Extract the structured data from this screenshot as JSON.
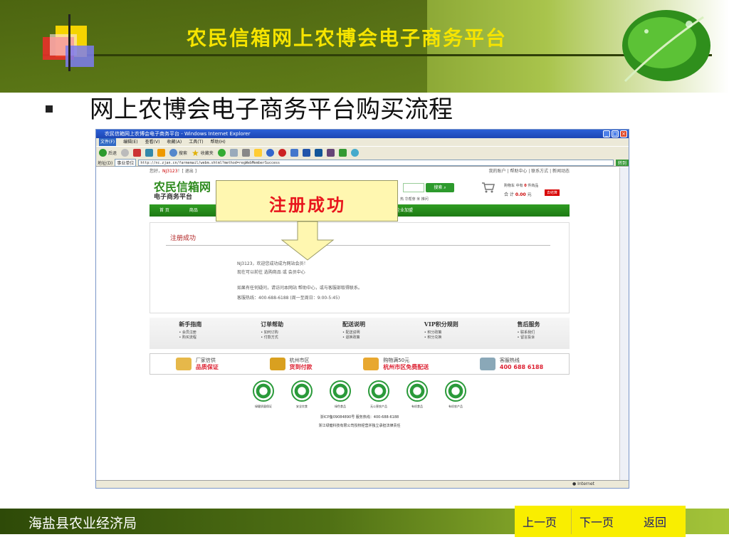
{
  "slide": {
    "title": "农民信箱网上农博会电子商务平台",
    "bullet": "网上农博会电子商务平台购买流程",
    "org_name": "海盐县农业经济局",
    "nav": {
      "prev": "上一页",
      "next": "下一页",
      "back": "返回"
    }
  },
  "callout": {
    "text": "注册成功"
  },
  "browser": {
    "window_title": "农民信箱网上农博会电子商务平台 - Windows Internet Explorer",
    "menu": [
      "文件(F)",
      "编辑(E)",
      "查看(V)",
      "收藏(A)",
      "工具(T)",
      "帮助(H)"
    ],
    "toolbar": {
      "back": "后退",
      "search": "搜索",
      "favorites": "收藏夹"
    },
    "address_label": "地址(D)",
    "address_tab": "事业单位",
    "url": "http://nc.zjan.cn/farmemail/webm.shtml?method=regWebMemberSuccess",
    "go_label": "转到",
    "status_zone": "Internet"
  },
  "site": {
    "greeting_prefix": "您好，",
    "username": "NJ3123",
    "logout": "！[ 退出 ]",
    "top_links": "我的账户 | 帮助中心 | 联系方式 | 新闻动态",
    "logo_line1": "农民信箱网",
    "logo_line2": "电子商务平台",
    "search_button": "搜索",
    "hot_words": "热 华帮芽 米 推问",
    "cart": {
      "label": "购物车 中有",
      "count": "0",
      "unit": "件商品",
      "total_label": "合 计",
      "total": "0.00",
      "currency": "元",
      "checkout": "去结算"
    },
    "nav": [
      "首 页",
      "商品",
      "浙",
      "企业加盟"
    ],
    "content": {
      "title": "注册成功",
      "line1": "NJ3123，欢迎您成功成为网站会员！",
      "line2": "现在可以前往 选购商品 或 会员中心",
      "line3": "如果有任何疑问，请访问本网站 帮助中心，或与客服部取得联系。",
      "line4": "客服热线：400-688-6188 (周一至周日：9:00-5:45)"
    },
    "footer_cols": [
      {
        "title": "新手指南",
        "items": [
          "• 会员注册",
          "• 购买流程"
        ]
      },
      {
        "title": "订单帮助",
        "items": [
          "• 如何订购",
          "• 付款方式"
        ]
      },
      {
        "title": "配送说明",
        "items": [
          "• 配送说明",
          "• 退换政策"
        ]
      },
      {
        "title": "VIP积分规则",
        "items": [
          "• 积分政策",
          "• 积分兑换"
        ]
      },
      {
        "title": "售后服务",
        "items": [
          "• 联系我们",
          "• 留言投诉"
        ]
      }
    ],
    "services": [
      {
        "line1": "厂家信供",
        "line2": "品质保证"
      },
      {
        "line1": "杭州市区",
        "line2": "货到付款"
      },
      {
        "line1": "购物满50元",
        "line2": "杭州市区免费配送"
      },
      {
        "line1": "客服热线",
        "line2": "400 688 6188"
      }
    ],
    "certs": [
      "绿健质量保证",
      "安全饮食",
      "绿色食品",
      "无公害农产品",
      "有机食品",
      "有机农产品"
    ],
    "icp": "浙ICP备09084890号  服务热线：400-688-6188",
    "company": "浙江绿健科技有限公司授权经营并独立承担法律责任"
  }
}
